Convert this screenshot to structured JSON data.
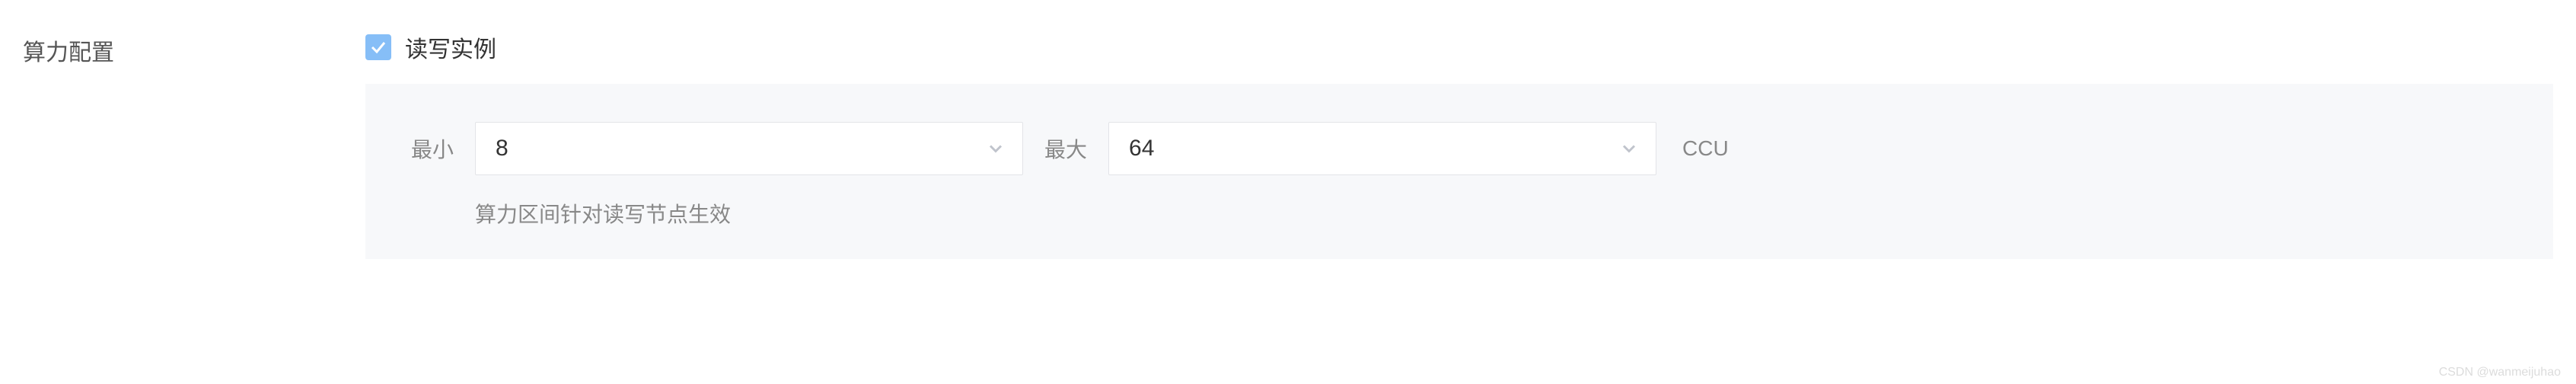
{
  "section": {
    "label": "算力配置"
  },
  "checkbox": {
    "checked": true,
    "label": "读写实例"
  },
  "panel": {
    "min_label": "最小",
    "min_value": "8",
    "max_label": "最大",
    "max_value": "64",
    "unit": "CCU",
    "helper": "算力区间针对读写节点生效"
  },
  "watermark": "CSDN @wanmeijuhao"
}
